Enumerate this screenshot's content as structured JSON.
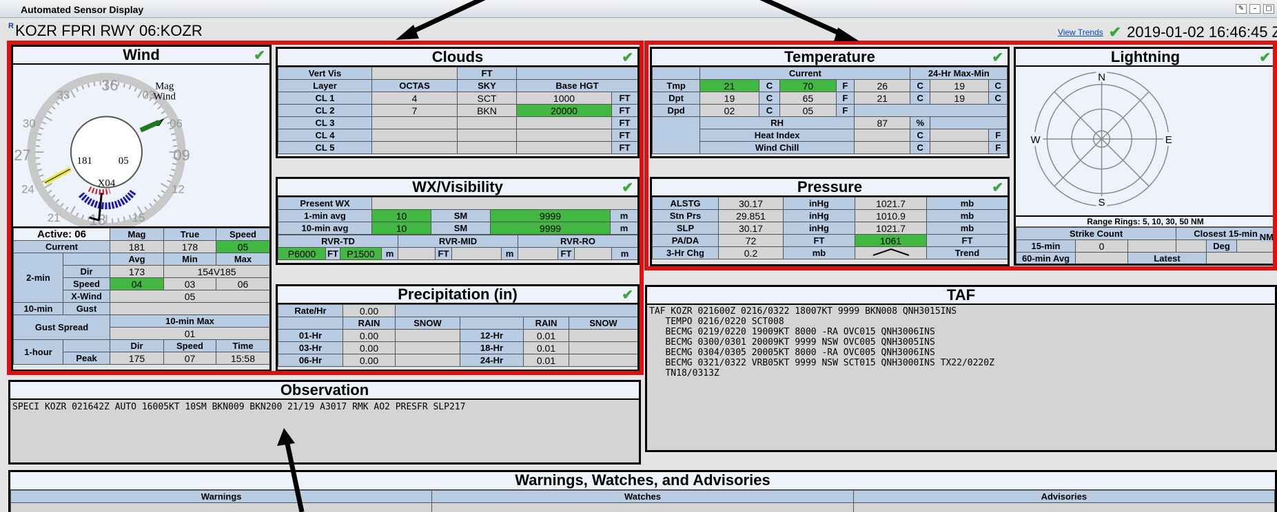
{
  "window": {
    "title": "Automated Sensor Display"
  },
  "station": {
    "name": "KOZR FPRI RWY 06:KOZR",
    "view_trends": "View Trends",
    "datetime": "2019-01-02 16:46:45 Z"
  },
  "wind": {
    "title": "Wind",
    "dial": {
      "mag_label": "Mag",
      "wind_label": "Wind",
      "tick_labels": [
        "33",
        "36",
        "03",
        "30",
        "06",
        "27",
        "09",
        "24",
        "12",
        "21",
        "18",
        "15"
      ],
      "left_value": "181",
      "right_value": "05",
      "center_value": "X04"
    },
    "active": "Active: 06",
    "cols": [
      "Mag",
      "True",
      "Speed"
    ],
    "current_label": "Current",
    "current": [
      "181",
      "178",
      "05"
    ],
    "two_min": {
      "label": "2-min",
      "cols": [
        "Avg",
        "Min",
        "Max"
      ],
      "dir_label": "Dir",
      "dir_avg": "173",
      "dir_range": "154V185",
      "speed_label": "Speed",
      "speed": [
        "04",
        "03",
        "06"
      ],
      "xwind_label": "X-Wind",
      "xwind": "05"
    },
    "ten_min_label": "10-min",
    "gust_label": "Gust",
    "gust_spread_label": "Gust Spread",
    "ten_min_max_label": "10-min Max",
    "ten_min_max": "01",
    "one_hour": {
      "label": "1-hour",
      "cols": [
        "Dir",
        "Speed",
        "Time"
      ],
      "peak_label": "Peak",
      "peak": [
        "175",
        "07",
        "15:58"
      ]
    }
  },
  "clouds": {
    "title": "Clouds",
    "vert_vis_label": "Vert Vis",
    "ft": "FT",
    "cols": [
      "Layer",
      "OCTAS",
      "SKY",
      "Base HGT"
    ],
    "rows": [
      {
        "layer": "CL 1",
        "octas": "4",
        "sky": "SCT",
        "hgt": "1000"
      },
      {
        "layer": "CL 2",
        "octas": "7",
        "sky": "BKN",
        "hgt": "20000"
      },
      {
        "layer": "CL 3",
        "octas": "",
        "sky": "",
        "hgt": ""
      },
      {
        "layer": "CL 4",
        "octas": "",
        "sky": "",
        "hgt": ""
      },
      {
        "layer": "CL 5",
        "octas": "",
        "sky": "",
        "hgt": ""
      }
    ]
  },
  "wx": {
    "title": "WX/Visibility",
    "present_label": "Present WX",
    "one_min_label": "1-min avg",
    "one_min": [
      "10",
      "SM",
      "9999",
      "m"
    ],
    "ten_min_label": "10-min avg",
    "ten_min": [
      "10",
      "SM",
      "9999",
      "m"
    ],
    "rvr_cols": [
      "RVR-TD",
      "RVR-MID",
      "RVR-RO"
    ],
    "rvr_td": "P6000",
    "rvr_td2": "P1500",
    "ft": "FT",
    "m": "m"
  },
  "precip": {
    "title": "Precipitation (in)",
    "rate_label": "Rate/Hr",
    "rate": "0.00",
    "rain": "RAIN",
    "snow": "SNOW",
    "rows": [
      {
        "l1": "01-Hr",
        "r1": "0.00",
        "l2": "12-Hr",
        "r2": "0.01"
      },
      {
        "l1": "03-Hr",
        "r1": "0.00",
        "l2": "18-Hr",
        "r2": "0.01"
      },
      {
        "l1": "06-Hr",
        "r1": "0.00",
        "l2": "24-Hr",
        "r2": "0.01"
      }
    ]
  },
  "temperature": {
    "title": "Temperature",
    "current_label": "Current",
    "maxmin_label": "24-Hr Max-Min",
    "rows": [
      {
        "label": "Tmp",
        "c": "21",
        "f": "70",
        "max": "26",
        "min": "19"
      },
      {
        "label": "Dpt",
        "c": "19",
        "f": "65",
        "max": "21",
        "min": "19"
      },
      {
        "label": "Dpd",
        "c": "02",
        "f": "05"
      }
    ],
    "c": "C",
    "f": "F",
    "rh_label": "RH",
    "rh": "87",
    "pct": "%",
    "heat_label": "Heat Index",
    "chill_label": "Wind Chill"
  },
  "pressure": {
    "title": "Pressure",
    "rows": [
      {
        "label": "ALSTG",
        "v1": "30.17",
        "u1": "inHg",
        "v2": "1021.7",
        "u2": "mb"
      },
      {
        "label": "Stn Prs",
        "v1": "29.851",
        "u1": "inHg",
        "v2": "1010.9",
        "u2": "mb"
      },
      {
        "label": "SLP",
        "v1": "30.17",
        "u1": "inHg",
        "v2": "1021.7",
        "u2": "mb"
      },
      {
        "label": "PA/DA",
        "v1": "72",
        "u1": "FT",
        "v2": "1061",
        "u2": "FT"
      },
      {
        "label": "3-Hr Chg",
        "v1": "0.2",
        "u1": "mb",
        "v2": "",
        "u2": "Trend"
      }
    ]
  },
  "lightning": {
    "title": "Lightning",
    "dirs": [
      "N",
      "E",
      "S",
      "W"
    ],
    "range_rings": "Range Rings: 5, 10, 30, 50 NM",
    "strike_count": "Strike Count",
    "closest": "Closest 15-min",
    "fifteen": "15-min",
    "fifteen_val": "0",
    "deg": "Deg",
    "nm": "NM",
    "sixty": "60-min Avg",
    "latest": "Latest"
  },
  "taf": {
    "title": "TAF",
    "lines": [
      "TAF KOZR 021600Z 0216/0322 18007KT 9999 BKN008 QNH3015INS",
      "   TEMPO 0216/0220 SCT008",
      "   BECMG 0219/0220 19009KT 8000 -RA OVC015 QNH3006INS",
      "   BECMG 0300/0301 20009KT 9999 NSW OVC005 QNH3005INS",
      "   BECMG 0304/0305 20005KT 8000 -RA OVC005 QNH3006INS",
      "   BECMG 0321/0322 VRB05KT 9999 NSW SCT015 QNH3000INS TX22/0220Z",
      "   TN18/0313Z"
    ]
  },
  "observation": {
    "title": "Observation",
    "text": "SPECI KOZR 021642Z AUTO 16005KT 10SM BKN009 BKN200 21/19 A3017 RMK AO2 PRESFR SLP217"
  },
  "warnings": {
    "title": "Warnings, Watches, and Advisories",
    "cols": [
      "Warnings",
      "Watches",
      "Advisories"
    ]
  },
  "colors": {
    "highlight_green": "#42b842",
    "header_blue": "#b8cce4",
    "annotation_red": "#e01010"
  }
}
